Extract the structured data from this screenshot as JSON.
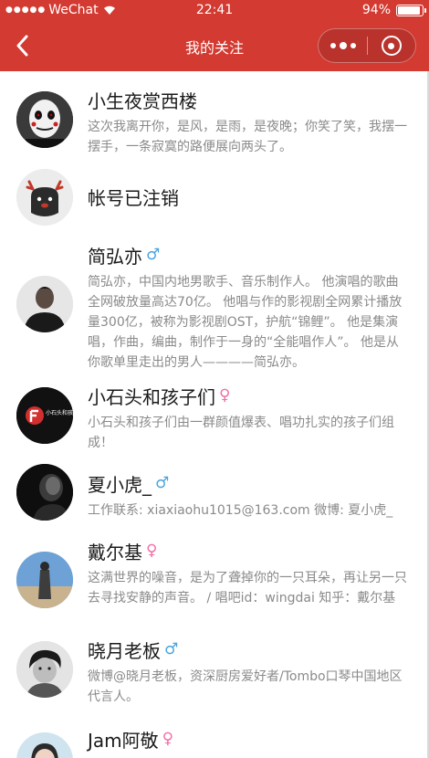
{
  "status_bar": {
    "signal": "●●●●●",
    "carrier": "WeChat",
    "time": "22:41",
    "battery": "94%",
    "battery_level": 0.94
  },
  "nav": {
    "title": "我的关注",
    "back_icon": "chevron-left-icon",
    "more_icon": "more-dots-icon",
    "close_icon": "target-close-icon"
  },
  "follows": [
    {
      "name": "小生夜赏西楼",
      "gender": "",
      "bio": "这次我离开你，是风，是雨，是夜晚；你笑了笑，我摆一摆手，一条寂寞的路便展向两头了。"
    },
    {
      "name": "帐号已注销",
      "gender": "",
      "bio": ""
    },
    {
      "name": "简弘亦",
      "gender": "♂",
      "bio": "简弘亦，中国内地男歌手、音乐制作人。 他演唱的歌曲全网破放量高达70亿。 他唱与作的影视剧全网累计播放量300亿，被称为影视剧OST，护航“锦鲤”。 他是集演唱，作曲，编曲，制作于一身的“全能唱作人”。 他是从你歌单里走出的男人————简弘亦。"
    },
    {
      "name": "小石头和孩子们",
      "gender": "♀",
      "bio": "小石头和孩子们由一群颜值爆表、唱功扎实的孩子们组成！",
      "avatar_text": "小石头和孩子们"
    },
    {
      "name": "夏小虎_",
      "gender": "♂",
      "bio": "工作联系: xiaxiaohu1015@163.com 微博: 夏小虎_"
    },
    {
      "name": "戴尔基",
      "gender": "♀",
      "bio": "这满世界的噪音，是为了聋掉你的一只耳朵，再让另一只去寻找安静的声音。 / 唱吧id：wingdai 知乎：戴尔基"
    },
    {
      "name": "晓月老板",
      "gender": "♂",
      "bio": "微博@晓月老板，资深厨房爱好者/Tombo口琴中国地区代言人。"
    },
    {
      "name": "Jam阿敬",
      "gender": "♀",
      "bio": ""
    }
  ],
  "colors": {
    "header_red": "#d33a31",
    "male": "#4aa3df",
    "female": "#f06fa6"
  }
}
